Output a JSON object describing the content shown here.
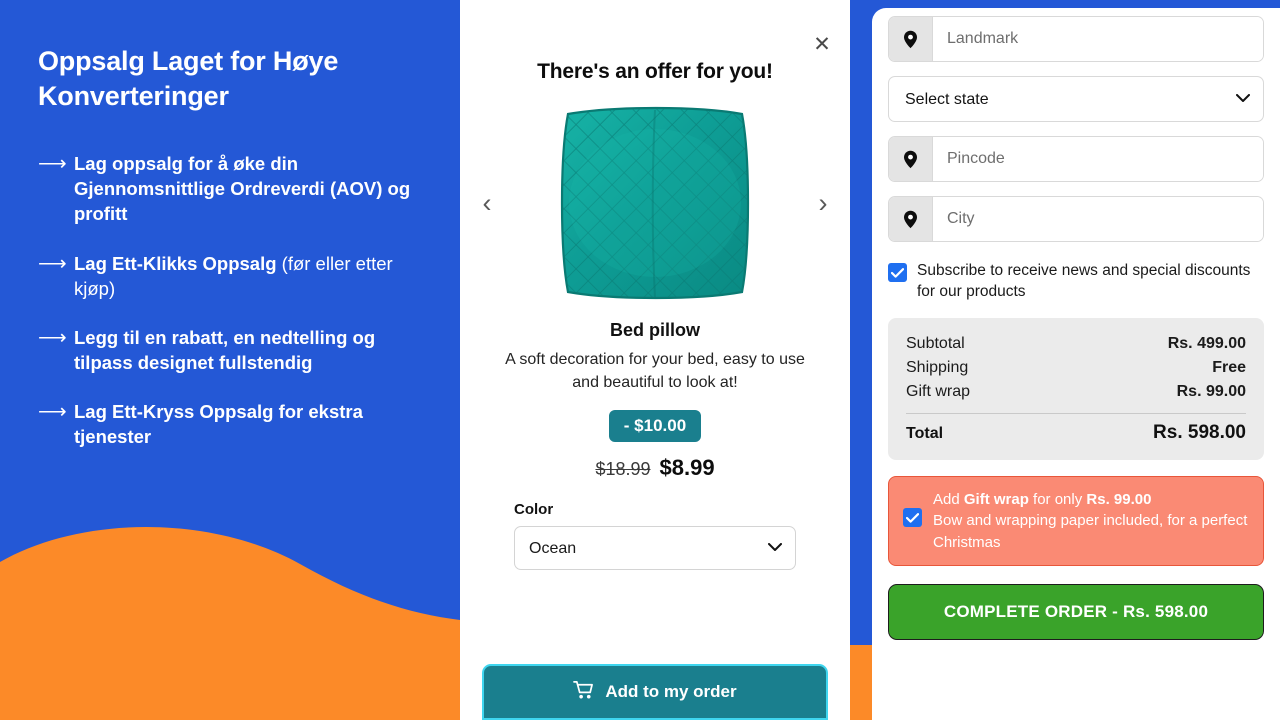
{
  "promo": {
    "title": "Oppsalg Laget for Høye Konverteringer",
    "bullets": [
      {
        "arrow": "arrow-right-icon",
        "bold": "Lag oppsalg for å øke din Gjennomsnittlige Ordreverdi (AOV) og profitt",
        "light": ""
      },
      {
        "arrow": "arrow-right-icon",
        "bold": "Lag Ett-Klikks Oppsalg ",
        "light": "(før eller etter kjøp)"
      },
      {
        "arrow": "arrow-right-icon",
        "bold": "Legg til en rabatt, en nedtelling og tilpass designet fullstendig",
        "light": ""
      },
      {
        "arrow": "arrow-right-icon",
        "bold": "Lag Ett-Kryss Oppsalg for ekstra tjenester",
        "light": ""
      }
    ]
  },
  "offer": {
    "close_label": "✕",
    "heading": "There's an offer for you!",
    "prev_arrow": "‹",
    "next_arrow": "›",
    "product_name": "Bed pillow",
    "product_description": "A soft decoration for your bed, easy to use and beautiful to look at!",
    "discount_badge": "- $10.00",
    "price_old": "$18.99",
    "price_new": "$8.99",
    "color_label": "Color",
    "color_value": "Ocean",
    "color_options": [
      "Ocean"
    ],
    "add_button": "Add to my order",
    "cart_icon": "shopping-cart-icon"
  },
  "checkout": {
    "landmark_placeholder": "Landmark",
    "state_value": "Select state",
    "state_options": [
      "Select state"
    ],
    "pincode_placeholder": "Pincode",
    "city_placeholder": "City",
    "pin_icon": "map-pin-icon",
    "subscribe_text": "Subscribe to receive news and special discounts for our products",
    "subscribe_checked": true,
    "summary": {
      "rows": [
        {
          "label": "Subtotal",
          "value": "Rs. 499.00"
        },
        {
          "label": "Shipping",
          "value": "Free"
        },
        {
          "label": "Gift wrap",
          "value": "Rs. 99.00"
        }
      ],
      "total_label": "Total",
      "total_value": "Rs. 598.00"
    },
    "giftwrap": {
      "checked": true,
      "line1_pre": "Add ",
      "line1_bold1": "Gift wrap",
      "line1_mid": " for only ",
      "line1_bold2": "Rs. 99.00",
      "line2": "Bow and wrapping paper included, for a perfect Christmas"
    },
    "complete_button": "COMPLETE ORDER - Rs. 598.00"
  },
  "colors": {
    "brand_blue": "#2458d6",
    "brand_orange": "#fc8a28",
    "teal": "#1a7f8e",
    "teal_glow": "#3fd6ef",
    "green": "#3aa32a",
    "salmon": "#fa8a74",
    "checkbox_blue": "#1f6ff0"
  }
}
